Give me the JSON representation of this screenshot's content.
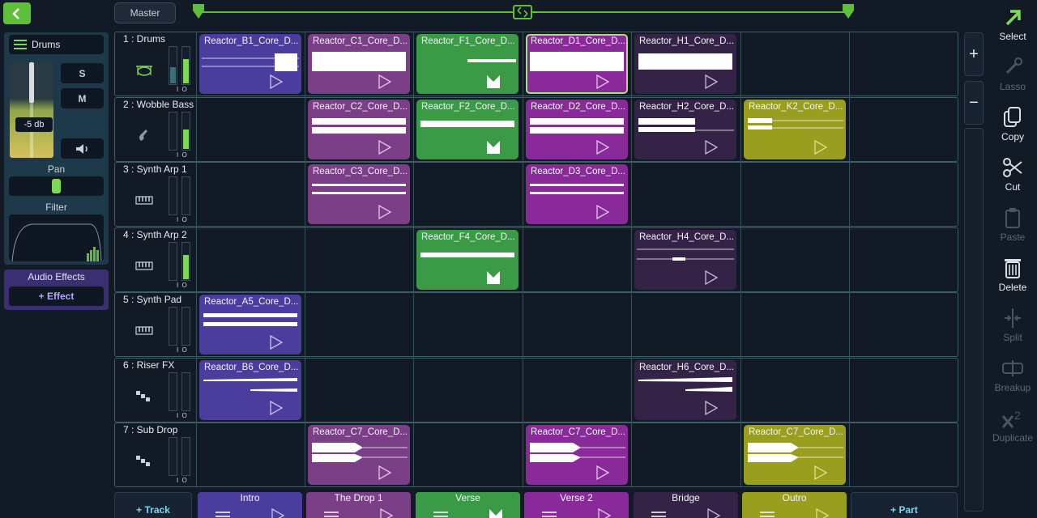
{
  "left_panel": {
    "track_name": "Drums",
    "volume_label": "-5 db",
    "solo_label": "S",
    "mute_label": "M",
    "pan_label": "Pan",
    "filter_label": "Filter",
    "audio_effects_title": "Audio Effects",
    "add_effect_label": "+ Effect"
  },
  "top": {
    "master_label": "Master"
  },
  "tracks": [
    {
      "name": "1 : Drums",
      "meter_label": "I O"
    },
    {
      "name": "2 : Wobble Bass",
      "meter_label": "I O"
    },
    {
      "name": "3 : Synth Arp 1",
      "meter_label": "I O"
    },
    {
      "name": "4 : Synth Arp 2",
      "meter_label": "I O"
    },
    {
      "name": "5 : Synth Pad",
      "meter_label": "I O"
    },
    {
      "name": "6 : Riser FX",
      "meter_label": "I O"
    },
    {
      "name": "7 : Sub Drop",
      "meter_label": "I O"
    }
  ],
  "clips": {
    "c1_1": "Reactor_B1_Core_D...",
    "c1_2": "Reactor_C1_Core_D...",
    "c1_3": "Reactor_F1_Core_D...",
    "c1_4": "Reactor_D1_Core_D...",
    "c1_5": "Reactor_H1_Core_D...",
    "c2_2": "Reactor_C2_Core_D...",
    "c2_3": "Reactor_F2_Core_D...",
    "c2_4": "Reactor_D2_Core_D...",
    "c2_5": "Reactor_H2_Core_D...",
    "c2_6": "Reactor_K2_Core_D...",
    "c3_2": "Reactor_C3_Core_D...",
    "c3_4": "Reactor_D3_Core_D...",
    "c4_3": "Reactor_F4_Core_D...",
    "c4_5": "Reactor_H4_Core_D...",
    "c5_1": "Reactor_A5_Core_D...",
    "c6_1": "Reactor_B6_Core_D...",
    "c6_5": "Reactor_H6_Core_D...",
    "c7_2": "Reactor_C7_Core_D...",
    "c7_4": "Reactor_C7_Core_D...",
    "c7_6": "Reactor_C7_Core_D..."
  },
  "parts": {
    "add_track": "+ Track",
    "p1": "Intro",
    "p2": "The Drop 1",
    "p3": "Verse",
    "p4": "Verse 2",
    "p5": "Bridge",
    "p6": "Outro",
    "add_part": "+ Part"
  },
  "zoom": {
    "in": "+",
    "out": "−"
  },
  "tools": {
    "select": "Select",
    "lasso": "Lasso",
    "copy": "Copy",
    "cut": "Cut",
    "paste": "Paste",
    "delete": "Delete",
    "split": "Split",
    "breakup": "Breakup",
    "duplicate": "Duplicate"
  },
  "colors": {
    "accent_green": "#7ed957",
    "blue_clip": "#4a3d9e",
    "pink_clip": "#7a3f86",
    "green_clip": "#3b9a46",
    "magenta_clip": "#8a2a9a",
    "dark_purple_clip": "#352347",
    "olive_clip": "#9a9e1e"
  }
}
